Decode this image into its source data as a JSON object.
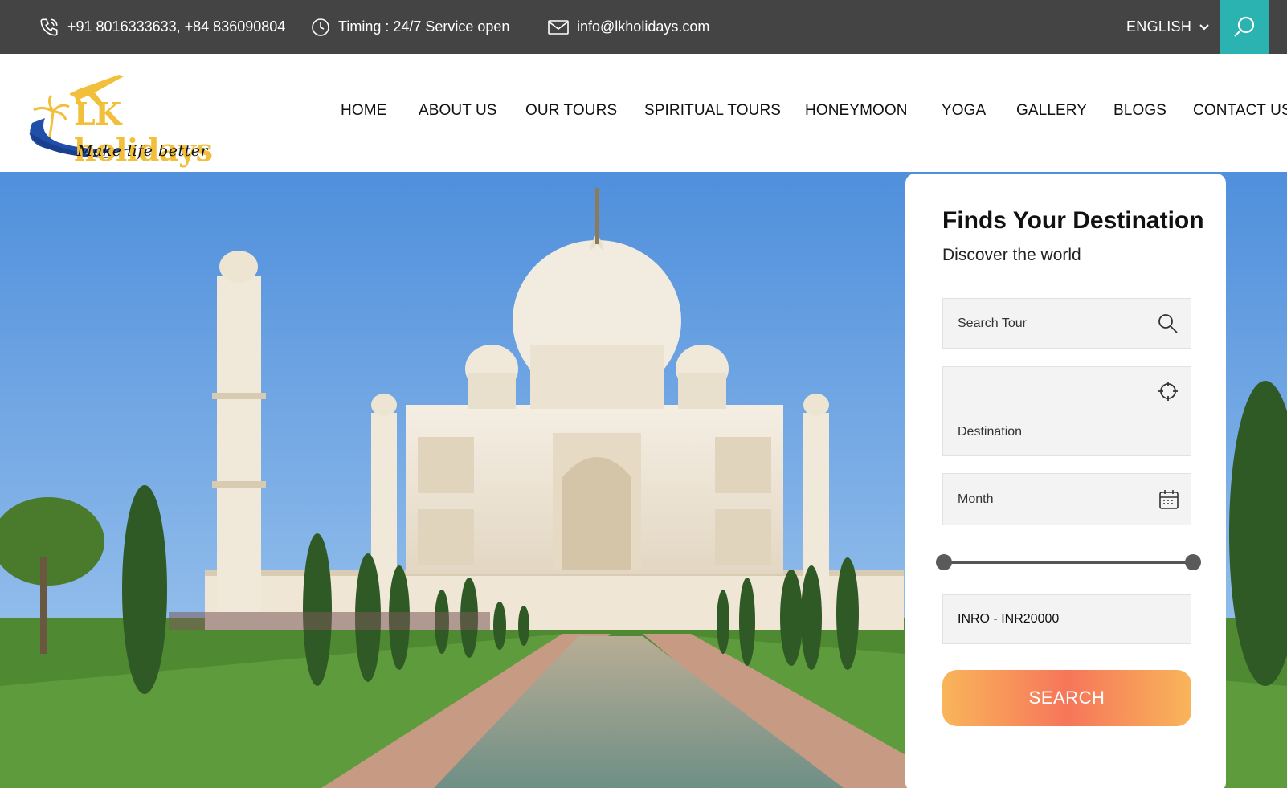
{
  "topbar": {
    "phone": "+91 8016333633, +84 836090804",
    "timing": "Timing : 24/7 Service open",
    "email": "info@lkholidays.com",
    "language": "ENGLISH"
  },
  "logo": {
    "name": "LK holidays",
    "tagline": "Make life better"
  },
  "nav": {
    "items": [
      "HOME",
      "ABOUT US",
      "OUR TOURS",
      "SPIRITUAL TOURS",
      "HONEYMOON",
      "YOGA",
      "GALLERY",
      "BLOGS",
      "CONTACT US"
    ]
  },
  "search_panel": {
    "title": "Finds Your Destination",
    "subtitle": "Discover the world",
    "search_tour_placeholder": "Search Tour",
    "destination_placeholder": "Destination",
    "month_placeholder": "Month",
    "price_range": "INRO - INR20000",
    "search_button": "SEARCH"
  },
  "colors": {
    "topbar_bg": "#444444",
    "accent_teal": "#2ab3b0",
    "logo_yellow": "#f2bf3a",
    "button_gradient": [
      "#f9b55a",
      "#f6765a"
    ]
  }
}
